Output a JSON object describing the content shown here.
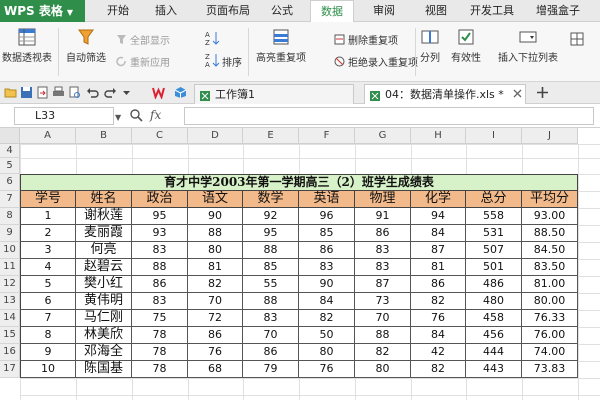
{
  "app": {
    "name": "WPS 表格"
  },
  "menu": [
    "开始",
    "插入",
    "页面布局",
    "公式",
    "数据",
    "审阅",
    "视图",
    "开发工具",
    "增强盒子"
  ],
  "active_menu": "数据",
  "ribbon": {
    "pivot": "数据透视表",
    "autofilter": "自动筛选",
    "show_all": "全部显示",
    "reapply": "重新应用",
    "sort": "排序",
    "highlight_dup": "高亮重复项",
    "remove_dup": "删除重复项",
    "reject_dup": "拒绝录入重复项",
    "split": "分列",
    "validity": "有效性",
    "insert_dropdown": "插入下拉列表"
  },
  "doc_tabs": {
    "workbook1": "工作簿1",
    "current": "04：数据清单操作.xls *"
  },
  "formula_bar": {
    "cell_ref": "L33",
    "fx": "fx",
    "formula": ""
  },
  "columns": [
    "A",
    "B",
    "C",
    "D",
    "E",
    "F",
    "G",
    "H",
    "I",
    "J"
  ],
  "rows": [
    "4",
    "5",
    "6",
    "7",
    "8",
    "9",
    "10",
    "11",
    "12",
    "13",
    "14",
    "15",
    "16",
    "17"
  ],
  "sheet": {
    "title": "育才中学2003年第一学期高三（2）班学生成绩表",
    "headers": [
      "学号",
      "姓名",
      "政治",
      "语文",
      "数学",
      "英语",
      "物理",
      "化学",
      "总分",
      "平均分"
    ],
    "records": [
      [
        "1",
        "谢秋莲",
        "95",
        "90",
        "92",
        "96",
        "91",
        "94",
        "558",
        "93.00"
      ],
      [
        "2",
        "麦丽霞",
        "93",
        "88",
        "95",
        "85",
        "86",
        "84",
        "531",
        "88.50"
      ],
      [
        "3",
        "何亮",
        "83",
        "80",
        "88",
        "86",
        "83",
        "87",
        "507",
        "84.50"
      ],
      [
        "4",
        "赵碧云",
        "88",
        "81",
        "85",
        "83",
        "83",
        "81",
        "501",
        "83.50"
      ],
      [
        "5",
        "樊小红",
        "86",
        "82",
        "55",
        "90",
        "87",
        "86",
        "486",
        "81.00"
      ],
      [
        "6",
        "黄伟明",
        "83",
        "70",
        "88",
        "84",
        "73",
        "82",
        "480",
        "80.00"
      ],
      [
        "7",
        "马仁刚",
        "75",
        "72",
        "83",
        "82",
        "70",
        "76",
        "458",
        "76.33"
      ],
      [
        "8",
        "林美欣",
        "78",
        "86",
        "70",
        "50",
        "88",
        "84",
        "456",
        "76.00"
      ],
      [
        "9",
        "邓海全",
        "78",
        "76",
        "86",
        "80",
        "82",
        "42",
        "444",
        "74.00"
      ],
      [
        "10",
        "陈国基",
        "78",
        "68",
        "79",
        "76",
        "80",
        "82",
        "443",
        "73.83"
      ]
    ]
  }
}
